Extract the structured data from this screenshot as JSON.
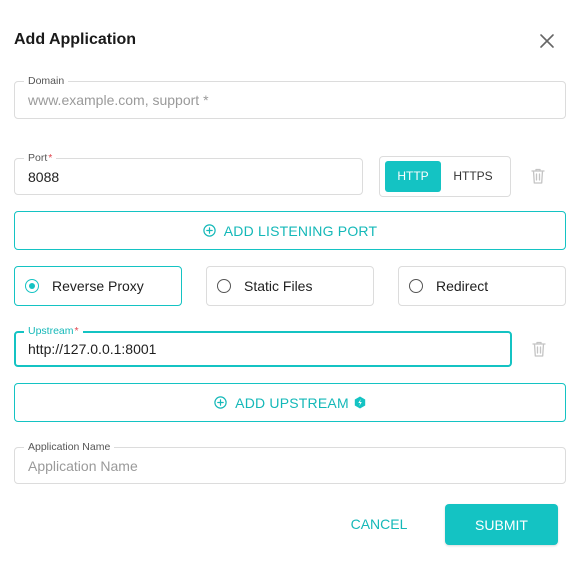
{
  "dialog": {
    "title": "Add Application",
    "close_icon": "close-icon"
  },
  "domain": {
    "label": "Domain",
    "value": "",
    "placeholder": "www.example.com, support *"
  },
  "port": {
    "label": "Port",
    "required_mark": "*",
    "value": "8088",
    "protocols": [
      "HTTP",
      "HTTPS"
    ],
    "selected_protocol": "HTTP",
    "delete_icon": "trash-icon"
  },
  "add_listening_port": {
    "label": "ADD LISTENING PORT",
    "icon": "plus-circle-icon"
  },
  "mode": {
    "options": [
      "Reverse Proxy",
      "Static Files",
      "Redirect"
    ],
    "selected": "Reverse Proxy"
  },
  "upstream": {
    "label": "Upstream",
    "required_mark": "*",
    "value": "http://127.0.0.1:8001",
    "delete_icon": "trash-icon"
  },
  "add_upstream": {
    "label": "ADD UPSTREAM",
    "icon": "plus-circle-icon",
    "badge_icon": "premium-badge-icon"
  },
  "application_name": {
    "label": "Application Name",
    "value": "",
    "placeholder": "Application Name"
  },
  "actions": {
    "cancel": "CANCEL",
    "submit": "SUBMIT"
  },
  "colors": {
    "accent": "#14c3c3",
    "required": "#e0454f",
    "border": "#dcdcdc"
  }
}
